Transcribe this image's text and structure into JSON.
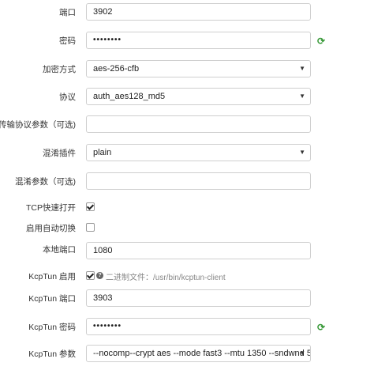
{
  "fields": {
    "port": {
      "label": "端口",
      "value": "3902"
    },
    "password": {
      "label": "密码",
      "value": "••••••••"
    },
    "encryption": {
      "label": "加密方式",
      "value": "aes-256-cfb"
    },
    "protocol": {
      "label": "协议",
      "value": "auth_aes128_md5"
    },
    "protocol_param": {
      "label": "传输协议参数（可选)",
      "value": ""
    },
    "obfs": {
      "label": "混淆插件",
      "value": "plain"
    },
    "obfs_param": {
      "label": "混淆参数（可选)",
      "value": ""
    },
    "tcp_fast_open": {
      "label": "TCP快速打开",
      "checked": true
    },
    "auto_switch": {
      "label": "启用自动切换",
      "checked": false
    },
    "local_port": {
      "label": "本地端口",
      "value": "1080"
    },
    "kcptun_enable": {
      "label": "KcpTun 启用",
      "checked": true,
      "help": "二进制文件：/usr/bin/kcptun-client"
    },
    "kcptun_port": {
      "label": "KcpTun 端口",
      "value": "3903"
    },
    "kcptun_password": {
      "label": "KcpTun 密码",
      "value": "••••••••"
    },
    "kcptun_param": {
      "label": "KcpTun 参数",
      "value": "--nocomp--crypt aes --mode fast3 --mtu 1350 --sndwnd 5"
    }
  },
  "icons": {
    "dropdown": "caret-down-icon",
    "refresh": "refresh-icon",
    "help": "question-circle-icon"
  },
  "glyphs": {
    "caret": "▼",
    "refresh": "⟳",
    "help": "?"
  }
}
